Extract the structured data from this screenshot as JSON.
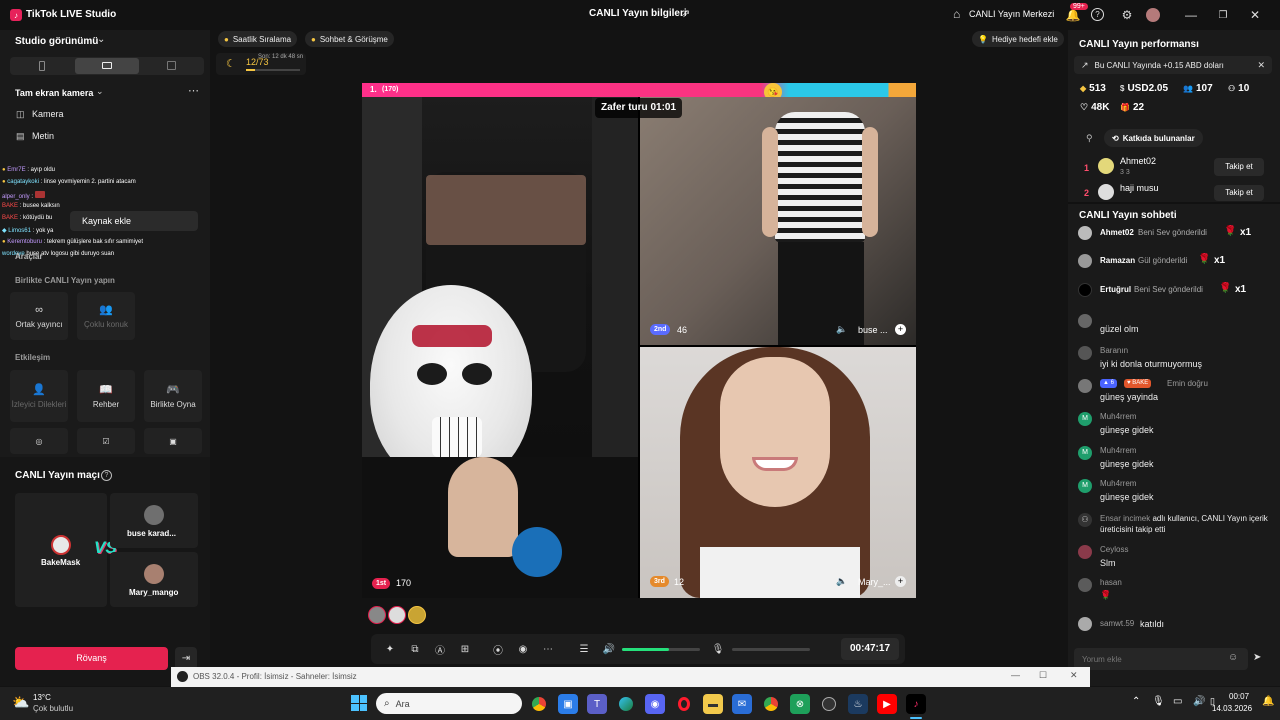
{
  "titlebar": {
    "app_title": "TikTok LIVE Studio",
    "center_title": "CANLI Yayın bilgileri",
    "live_center": "CANLI Yayın Merkezi",
    "notif_badge": "99+"
  },
  "left": {
    "studio_view": "Studio görünümü",
    "fullscreen_camera": "Tam ekran kamera",
    "camera": "Kamera",
    "text": "Metin",
    "add_source": "Kaynak ekle",
    "tools": "Araçlar",
    "cohost_header": "Birlikte CANLI Yayın yapın",
    "cohost_tiles": [
      "Ortak yayıncı",
      "Çoklu konuk"
    ],
    "interaction_header": "Etkileşim",
    "interaction_tiles": [
      "İzleyici Dilekleri",
      "Rehber",
      "Birlikte Oyna"
    ],
    "chat_overlay": [
      {
        "name": "Emr7E",
        "msg": ": ayıp oldu",
        "color": "#c39bff"
      },
      {
        "name": "cagataykoki",
        "msg": ": linse yovmiyemin 2. partini atacam",
        "color": "#7fe3ff"
      },
      {
        "name": "alper_only",
        "msg": ":",
        "color": "#c39bff"
      },
      {
        "name": "BAKE",
        "msg": ": busee kalksın",
        "color": "#ff6a6a"
      },
      {
        "name": "BAKE",
        "msg": ": kötüydü bu",
        "color": "#ff6a6a"
      },
      {
        "name": "Limos61",
        "msg": ": yok ya",
        "color": "#7fe3ff"
      },
      {
        "name": "Keremtoburu",
        "msg": ": tekrem gülüşlere bak sıfır samimiyet",
        "color": "#c39bff"
      },
      {
        "name": "wordeye",
        "msg": "buse atv logosu gibi duruyo suan",
        "color": "#7fe3ff"
      }
    ],
    "match_title": "CANLI Yayın maçı",
    "match_players": [
      "BakeMask",
      "buse karad...",
      "Mary_mango"
    ],
    "rematch": "Rövanş"
  },
  "center": {
    "ranking": "Saatlik Sıralama",
    "chat_meet": "Sohbet & Görüşme",
    "gift_goal": "Hediye hedefi ekle",
    "progress_text": "12/73",
    "progress_sub": "Son: 12 dk 48 sn",
    "battle_rank": "1.",
    "battle_score": "(170)",
    "victory_round": "Zafer turu 01:01",
    "p1_badge": "1st",
    "p1_score": "170",
    "p2_badge": "2nd",
    "p2_score": "46",
    "p2_name": "buse ...",
    "p3_badge": "3rd",
    "p3_score": "12",
    "p3_name": "Mary_...",
    "timer": "00:47:17",
    "volume_level": 0.6
  },
  "right": {
    "perf_title": "CANLI Yayın performansı",
    "earning_note": "Bu CANLI Yayında +0.15 ABD doları",
    "stats": {
      "coins": "513",
      "usd": "USD2.05",
      "viewers": "107",
      "gifters": "10",
      "likes": "48K",
      "gifts": "22"
    },
    "contributors_btn": "Katkıda bulunanlar",
    "top": [
      {
        "rank": "1",
        "name": "Ahmet02",
        "meta": "3  3",
        "follow": "Takip et"
      },
      {
        "rank": "2",
        "name": "haji musu",
        "meta": "",
        "follow": "Takip et"
      }
    ],
    "chat_title": "CANLI Yayın sohbeti",
    "gift_events": [
      {
        "name": "Ahmet02",
        "text": "Beni Sev gönderildi",
        "count": "x1"
      },
      {
        "name": "Ramazan",
        "text": "Gül gönderildi",
        "count": "x1"
      },
      {
        "name": "Ertuğrul",
        "text": "Beni Sev gönderildi",
        "count": "x1"
      }
    ],
    "chat": [
      {
        "name": "",
        "msg": "güzel olm"
      },
      {
        "name": "Baranın",
        "msg": "iyi ki donla oturmuyormuş"
      },
      {
        "name": "Emin doğru",
        "msg": "güneş yayinda",
        "badge1": "6",
        "badge2": "BAKE"
      },
      {
        "name": "Muh4rrem",
        "msg": "güneşe gidek"
      },
      {
        "name": "Muh4rrem",
        "msg": "güneşe gidek"
      },
      {
        "name": "Muh4rrem",
        "msg": "güneşe gidek"
      },
      {
        "name": "Ensar incimek",
        "msg": "adlı kullanıcı, CANLI Yayın içerik üreticisini takip etti"
      },
      {
        "name": "Ceyloss",
        "msg": "Slm"
      },
      {
        "name": "hasan",
        "msg": ""
      },
      {
        "name": "samwt.59",
        "msg": "katıldı"
      }
    ],
    "comment_placeholder": "Yorum ekle"
  },
  "obs": {
    "title": "OBS 32.0.4 - Profil: İsimsiz - Sahneler: İsimsiz"
  },
  "taskbar": {
    "temp": "13°C",
    "weather": "Çok bulutlu",
    "search": "Ara",
    "time": "00:07",
    "date": "14.03.2026"
  }
}
